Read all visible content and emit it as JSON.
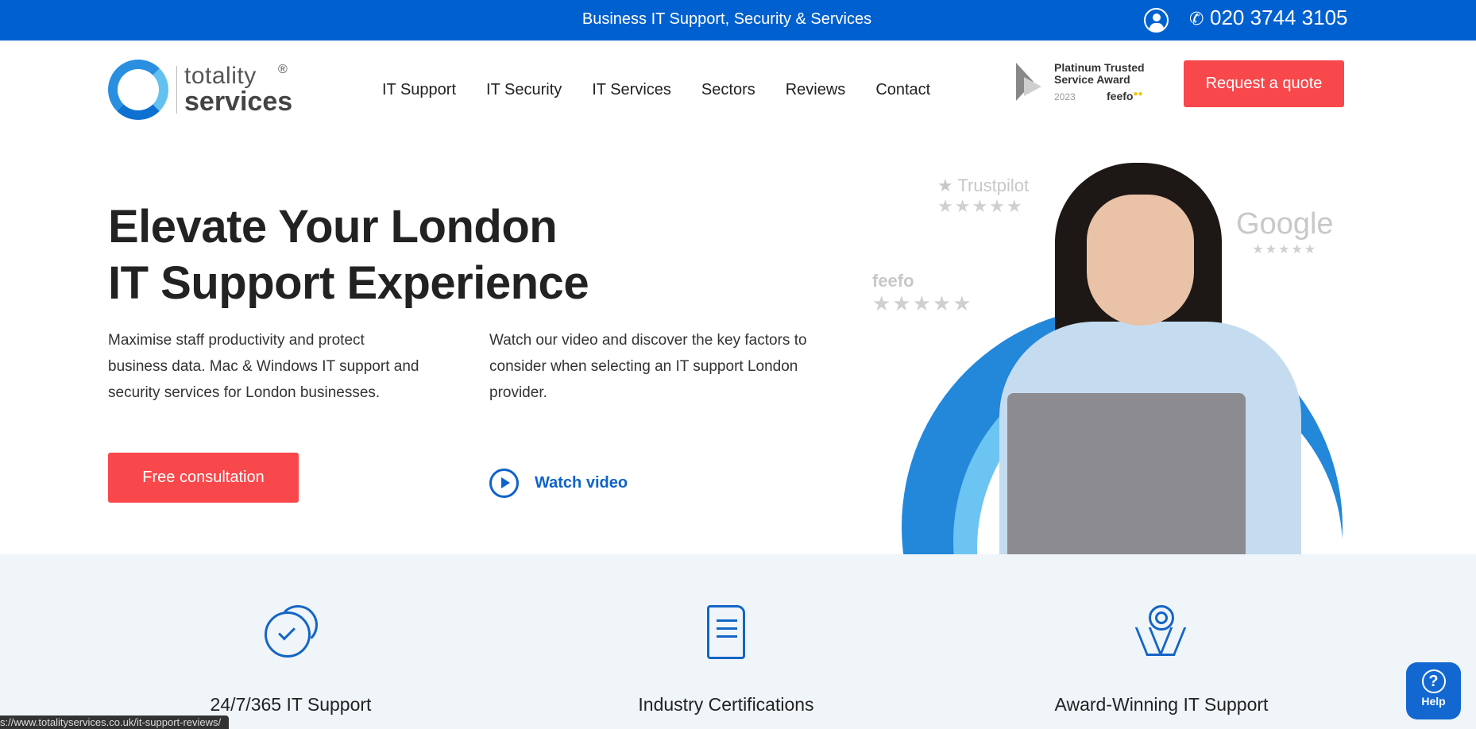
{
  "topbar": {
    "tagline": "Business IT Support, Security & Services",
    "account_icon": "user-circle-icon",
    "phone_icon": "phone-icon",
    "phone": "020 3744 3105",
    "background": "#0060cf"
  },
  "header": {
    "logo": {
      "line1": "totality",
      "line2": "services",
      "registered": "®"
    },
    "nav": [
      "IT Support",
      "IT Security",
      "IT Services",
      "Sectors",
      "Reviews",
      "Contact"
    ],
    "award": {
      "title": "Platinum Trusted Service Award",
      "year": "2023",
      "brand": "feefo"
    },
    "quote_button": "Request a quote"
  },
  "hero": {
    "heading_line1": "Elevate Your London",
    "heading_line2": "IT Support Experience",
    "lead": "Maximise staff productivity and protect business data. Mac & Windows IT support and security services for London businesses.",
    "lead2": "Watch our video and discover the key factors to consider when selecting an IT support London provider.",
    "consult_button": "Free consultation",
    "watch_label": "Watch video",
    "review_badges": {
      "trustpilot": "Trustpilot",
      "google": "Google",
      "feefo": "feefo",
      "stars": "★★★★★"
    },
    "accent": "#f8484b",
    "link_color": "#0e63c9"
  },
  "features": [
    {
      "icon": "clock-check-icon",
      "label": "24/7/365 IT Support"
    },
    {
      "icon": "certificate-scroll-icon",
      "label": "Industry Certifications"
    },
    {
      "icon": "award-ribbon-icon",
      "label": "Award-Winning IT Support"
    }
  ],
  "status_bar": {
    "url": "s://www.totalityservices.co.uk/it-support-reviews/"
  },
  "help_widget": {
    "icon": "question-icon",
    "glyph": "?",
    "label": "Help"
  }
}
